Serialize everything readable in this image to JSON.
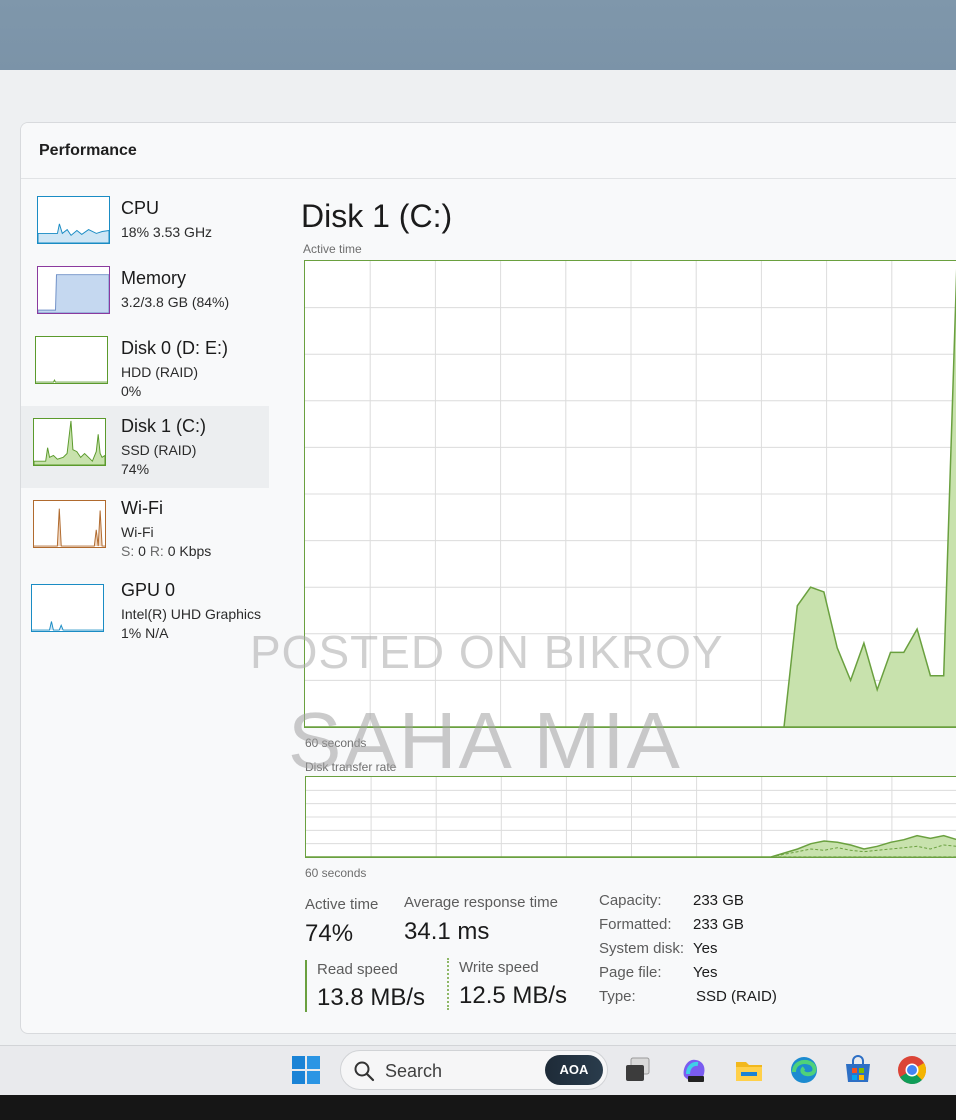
{
  "window": {
    "title": "Performance"
  },
  "sidebar": {
    "items": [
      {
        "name": "CPU",
        "line1": "18%  3.53 GHz",
        "line2": "",
        "color": "#1a8cc4"
      },
      {
        "name": "Memory",
        "line1": "3.2/3.8 GB (84%)",
        "line2": "",
        "color": "#8b3a9e"
      },
      {
        "name": "Disk 0 (D: E:)",
        "line1": "HDD (RAID)",
        "line2": "0%",
        "color": "#5b9a2c"
      },
      {
        "name": "Disk 1 (C:)",
        "line1": "SSD (RAID)",
        "line2": "74%",
        "color": "#5b9a2c",
        "selected": true
      },
      {
        "name": "Wi-Fi",
        "line1": "Wi-Fi",
        "line2_s_label": "S:",
        "line2_s_val": "0",
        "line2_r_label": "R:",
        "line2_r_val": "0 Kbps",
        "color": "#b06a2e"
      },
      {
        "name": "GPU 0",
        "line1": "Intel(R) UHD Graphics",
        "line2": "1% N/A",
        "color": "#1a8cc4"
      }
    ]
  },
  "main": {
    "title": "Disk 1 (C:)",
    "active_time_label": "Active time",
    "graph1_footer": "60 seconds",
    "transfer_label": "Disk transfer rate",
    "graph2_footer": "60 seconds",
    "stats": {
      "active_time": {
        "label": "Active time",
        "value": "74%"
      },
      "avg_response": {
        "label": "Average response time",
        "value": "34.1 ms"
      },
      "read_speed": {
        "label": "Read speed",
        "value": "13.8 MB/s"
      },
      "write_speed": {
        "label": "Write speed",
        "value": "12.5 MB/s"
      }
    },
    "properties": [
      {
        "label": "Capacity:",
        "value": "233 GB"
      },
      {
        "label": "Formatted:",
        "value": "233 GB"
      },
      {
        "label": "System disk:",
        "value": "Yes"
      },
      {
        "label": "Page file:",
        "value": "Yes"
      },
      {
        "label": "Type:",
        "value": "SSD (RAID)"
      }
    ]
  },
  "chart_data": [
    {
      "type": "area",
      "title": "Active time",
      "xlabel": "60 seconds",
      "ylim": [
        0,
        100
      ],
      "series": [
        {
          "values": [
            0,
            0,
            0,
            0,
            0,
            0,
            0,
            0,
            0,
            0,
            0,
            0,
            0,
            0,
            0,
            0,
            0,
            0,
            0,
            0,
            0,
            0,
            0,
            0,
            0,
            0,
            0,
            0,
            0,
            0,
            0,
            0,
            0,
            0,
            0,
            0,
            0,
            26,
            30,
            29,
            17,
            10,
            18,
            8,
            16,
            16,
            21,
            11,
            11,
            100
          ]
        }
      ]
    },
    {
      "type": "area",
      "title": "Disk transfer rate",
      "xlabel": "60 seconds",
      "series": [
        {
          "values": [
            0,
            0,
            0,
            0,
            0,
            0,
            0,
            0,
            0,
            0,
            0,
            0,
            0,
            0,
            0,
            0,
            0,
            0,
            0,
            0,
            0,
            0,
            0,
            0,
            0,
            0,
            0,
            0,
            0,
            0,
            0,
            0,
            0,
            0,
            0,
            0,
            3,
            6,
            10,
            12,
            11,
            9,
            6,
            8,
            11,
            13,
            16,
            14,
            16,
            13
          ]
        },
        {
          "values": [
            0,
            0,
            0,
            0,
            0,
            0,
            0,
            0,
            0,
            0,
            0,
            0,
            0,
            0,
            0,
            0,
            0,
            0,
            0,
            0,
            0,
            0,
            0,
            0,
            0,
            0,
            0,
            0,
            0,
            0,
            0,
            0,
            0,
            0,
            0,
            0,
            2,
            4,
            6,
            5,
            7,
            5,
            4,
            5,
            6,
            7,
            8,
            6,
            9,
            8
          ]
        }
      ]
    }
  ],
  "taskbar": {
    "search_placeholder": "Search",
    "copilot_badge": "AOA",
    "icons": [
      "windows-start-icon",
      "search-icon",
      "task-view-icon",
      "copilot-app-icon",
      "file-explorer-icon",
      "edge-browser-icon",
      "microsoft-store-icon",
      "chrome-browser-icon"
    ]
  },
  "watermark": {
    "line1": "POSTED ON BIKROY",
    "line2": "SAHA MIA"
  },
  "colors": {
    "disk_green": "#6aa03f",
    "disk_fill": "#c8e2ad",
    "grid": "#dcdcdc"
  }
}
